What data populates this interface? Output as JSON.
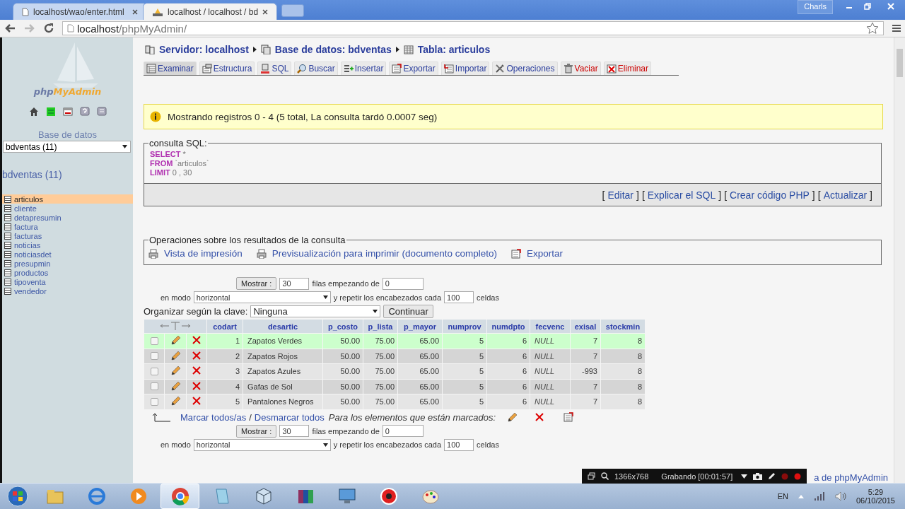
{
  "browser": {
    "tabs": [
      {
        "title": "localhost/wao/enter.html",
        "selected": false
      },
      {
        "title": "localhost / localhost / bd",
        "selected": true
      }
    ],
    "user": "Charls",
    "url_host": "localhost",
    "url_path": "/phpMyAdmin/"
  },
  "sidebar": {
    "logo": {
      "part_1": "php",
      "part_2": "MyAdmin"
    },
    "db_label": "Base de datos",
    "db_select": "bdventas (11)",
    "db_heading": "bdventas (11)",
    "tables": [
      {
        "name": "articulos",
        "selected": true
      },
      {
        "name": "cliente",
        "selected": false
      },
      {
        "name": "detapresumin",
        "selected": false
      },
      {
        "name": "factura",
        "selected": false
      },
      {
        "name": "facturas",
        "selected": false
      },
      {
        "name": "noticias",
        "selected": false
      },
      {
        "name": "noticiasdet",
        "selected": false
      },
      {
        "name": "presupmin",
        "selected": false
      },
      {
        "name": "productos",
        "selected": false
      },
      {
        "name": "tipoventa",
        "selected": false
      },
      {
        "name": "vendedor",
        "selected": false
      }
    ]
  },
  "breadcrumb": [
    {
      "label": "Servidor: localhost",
      "kind": "server"
    },
    {
      "label": "Base de datos: bdventas",
      "kind": "database"
    },
    {
      "label": "Tabla: articulos",
      "kind": "table"
    }
  ],
  "tabs": [
    {
      "label": "Examinar",
      "kind": "browse",
      "selected": true
    },
    {
      "label": "Estructura",
      "kind": "structure",
      "selected": false
    },
    {
      "label": "SQL",
      "kind": "sql",
      "selected": false
    },
    {
      "label": "Buscar",
      "kind": "search",
      "selected": false
    },
    {
      "label": "Insertar",
      "kind": "insert",
      "selected": false
    },
    {
      "label": "Exportar",
      "kind": "export",
      "selected": false
    },
    {
      "label": "Importar",
      "kind": "import",
      "selected": false
    },
    {
      "label": "Operaciones",
      "kind": "operations",
      "selected": false
    },
    {
      "label": "Vaciar",
      "kind": "empty",
      "selected": false
    },
    {
      "label": "Eliminar",
      "kind": "drop",
      "selected": false
    }
  ],
  "notice": "Mostrando registros 0 - 4 (5 total, La consulta tardó 0.0007 seg)",
  "sql_box": {
    "legend": "consulta SQL:",
    "lines": [
      {
        "keyword": "SELECT",
        "rest": "*"
      },
      {
        "keyword": "FROM",
        "rest": "`articulos`"
      },
      {
        "keyword": "LIMIT",
        "rest": "0 , 30"
      }
    ],
    "brackets": [
      "[",
      "]"
    ],
    "links": [
      "Editar",
      "Explicar el SQL",
      "Crear código PHP",
      "Actualizar"
    ]
  },
  "operations": {
    "legend": "Operaciones sobre los resultados de la consulta",
    "links": [
      {
        "label": "Vista de impresión",
        "kind": "print"
      },
      {
        "label": "Previsualización para imprimir (documento completo)",
        "kind": "print"
      },
      {
        "label": "Exportar",
        "kind": "export"
      }
    ]
  },
  "nav_top": {
    "show_button": "Mostrar :",
    "rows": "30",
    "start_label": "filas empezando de",
    "start": "0",
    "mode_label": "en modo",
    "mode": "horizontal",
    "repeat_label": "y repetir los encabezados cada",
    "repeat": "100",
    "cells_label": "celdas"
  },
  "sort": {
    "label": "Organizar según la clave:",
    "value": "Ninguna",
    "button": "Continuar"
  },
  "table": {
    "columns": [
      {
        "label": "codart",
        "kind": "number"
      },
      {
        "label": "desartic",
        "kind": "text"
      },
      {
        "label": "p_costo",
        "kind": "number"
      },
      {
        "label": "p_lista",
        "kind": "number"
      },
      {
        "label": "p_mayor",
        "kind": "number"
      },
      {
        "label": "numprov",
        "kind": "number"
      },
      {
        "label": "numdpto",
        "kind": "number"
      },
      {
        "label": "fecvenc",
        "kind": "date"
      },
      {
        "label": "exisal",
        "kind": "number"
      },
      {
        "label": "stockmin",
        "kind": "number"
      }
    ],
    "rows": [
      {
        "checked": false,
        "highlighted": true,
        "cells": [
          "1",
          "Zapatos Verdes",
          "50.00",
          "75.00",
          "65.00",
          "5",
          "6",
          "NULL",
          "7",
          "8"
        ]
      },
      {
        "checked": false,
        "highlighted": false,
        "cells": [
          "2",
          "Zapatos Rojos",
          "50.00",
          "75.00",
          "65.00",
          "5",
          "6",
          "NULL",
          "7",
          "8"
        ]
      },
      {
        "checked": false,
        "highlighted": false,
        "cells": [
          "3",
          "Zapatos Azules",
          "50.00",
          "75.00",
          "65.00",
          "5",
          "6",
          "NULL",
          "-993",
          "8"
        ]
      },
      {
        "checked": false,
        "highlighted": false,
        "cells": [
          "4",
          "Gafas de Sol",
          "50.00",
          "75.00",
          "65.00",
          "5",
          "6",
          "NULL",
          "7",
          "8"
        ]
      },
      {
        "checked": false,
        "highlighted": false,
        "cells": [
          "5",
          "Pantalones Negros",
          "50.00",
          "75.00",
          "65.00",
          "5",
          "6",
          "NULL",
          "7",
          "8"
        ]
      }
    ]
  },
  "mark_bar": {
    "check_all": "Marcar todos/as",
    "separator": "/",
    "uncheck_all": "Desmarcar todos",
    "with_selected": "Para los elementos que están marcados:"
  },
  "nav_bottom": {
    "show_button": "Mostrar :",
    "rows": "30",
    "start_label": "filas empezando de",
    "start": "0",
    "mode_label": "en modo",
    "mode": "horizontal",
    "repeat_label": "y repetir los encabezados cada",
    "repeat": "100",
    "cells_label": "celdas"
  },
  "footer_link": "a de phpMyAdmin",
  "recorder": {
    "resolution": "1366x768",
    "status": "Grabando [00:01:57]"
  },
  "taskbar": {
    "apps": [
      {
        "kind": "folder",
        "selected": false
      },
      {
        "kind": "ie",
        "selected": false
      },
      {
        "kind": "media",
        "selected": false
      },
      {
        "kind": "chrome",
        "selected": true
      },
      {
        "kind": "notepad",
        "selected": false
      },
      {
        "kind": "cube",
        "selected": false
      },
      {
        "kind": "archive",
        "selected": false
      },
      {
        "kind": "network",
        "selected": false
      },
      {
        "kind": "recorder",
        "selected": false
      },
      {
        "kind": "paint",
        "selected": false
      }
    ],
    "language": "EN",
    "time": "5:29",
    "date": "06/10/2015"
  }
}
